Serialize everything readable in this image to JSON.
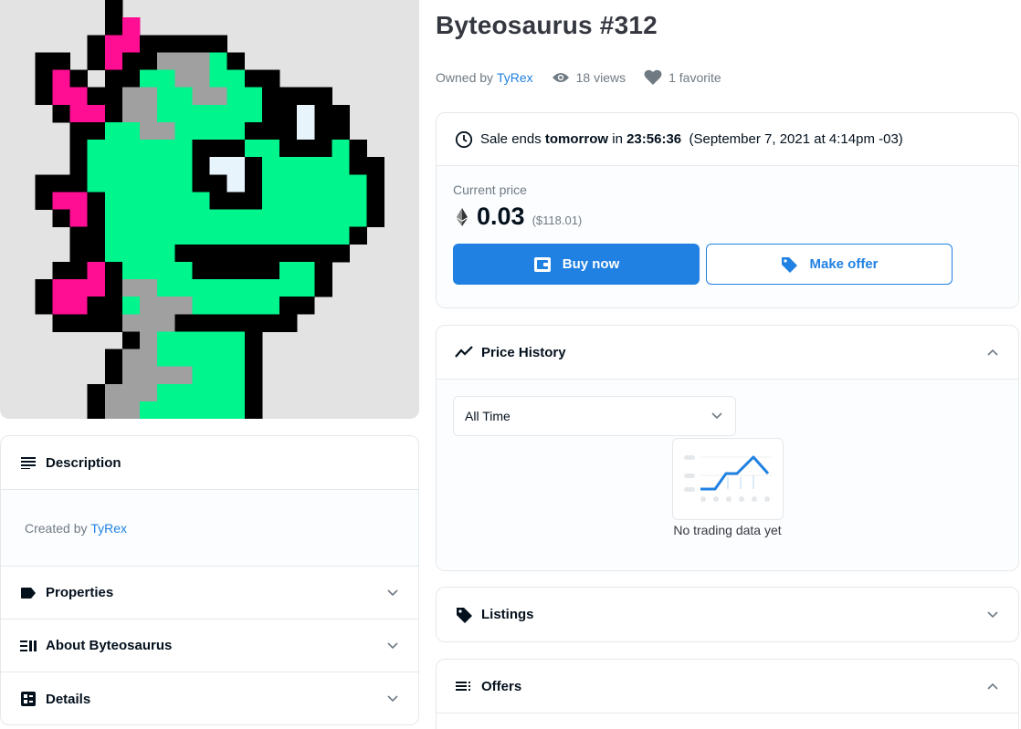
{
  "item": {
    "title": "Byteosaurus #312",
    "owned_by_label": "Owned by",
    "owner": "TyRex",
    "views": "18 views",
    "favorites": "1 favorite"
  },
  "description": {
    "header": "Description",
    "created_by_label": "Created by",
    "creator": "TyRex"
  },
  "left_sections": {
    "properties": "Properties",
    "about": "About Byteosaurus",
    "details": "Details"
  },
  "sale": {
    "ends_label": "Sale ends",
    "ends_when": "tomorrow",
    "ends_in": "in",
    "countdown": "23:56:36",
    "ends_date": "(September 7, 2021 at 4:14pm -03)",
    "current_price_label": "Current price",
    "price_eth": "0.03",
    "price_usd": "($118.01)",
    "buy_label": "Buy now",
    "offer_label": "Make offer"
  },
  "price_history": {
    "header": "Price History",
    "range_selected": "All Time",
    "empty_text": "No trading data yet"
  },
  "listings": {
    "header": "Listings"
  },
  "offers": {
    "header": "Offers"
  },
  "colors": {
    "accent": "#2081e2",
    "dino_green": "#00f58c",
    "dino_pink": "#ff0d92",
    "dino_grey": "#a0a0a0",
    "dino_eye": "#e8f4fb",
    "outline": "#000000",
    "art_bg": "#e3e3e3"
  }
}
